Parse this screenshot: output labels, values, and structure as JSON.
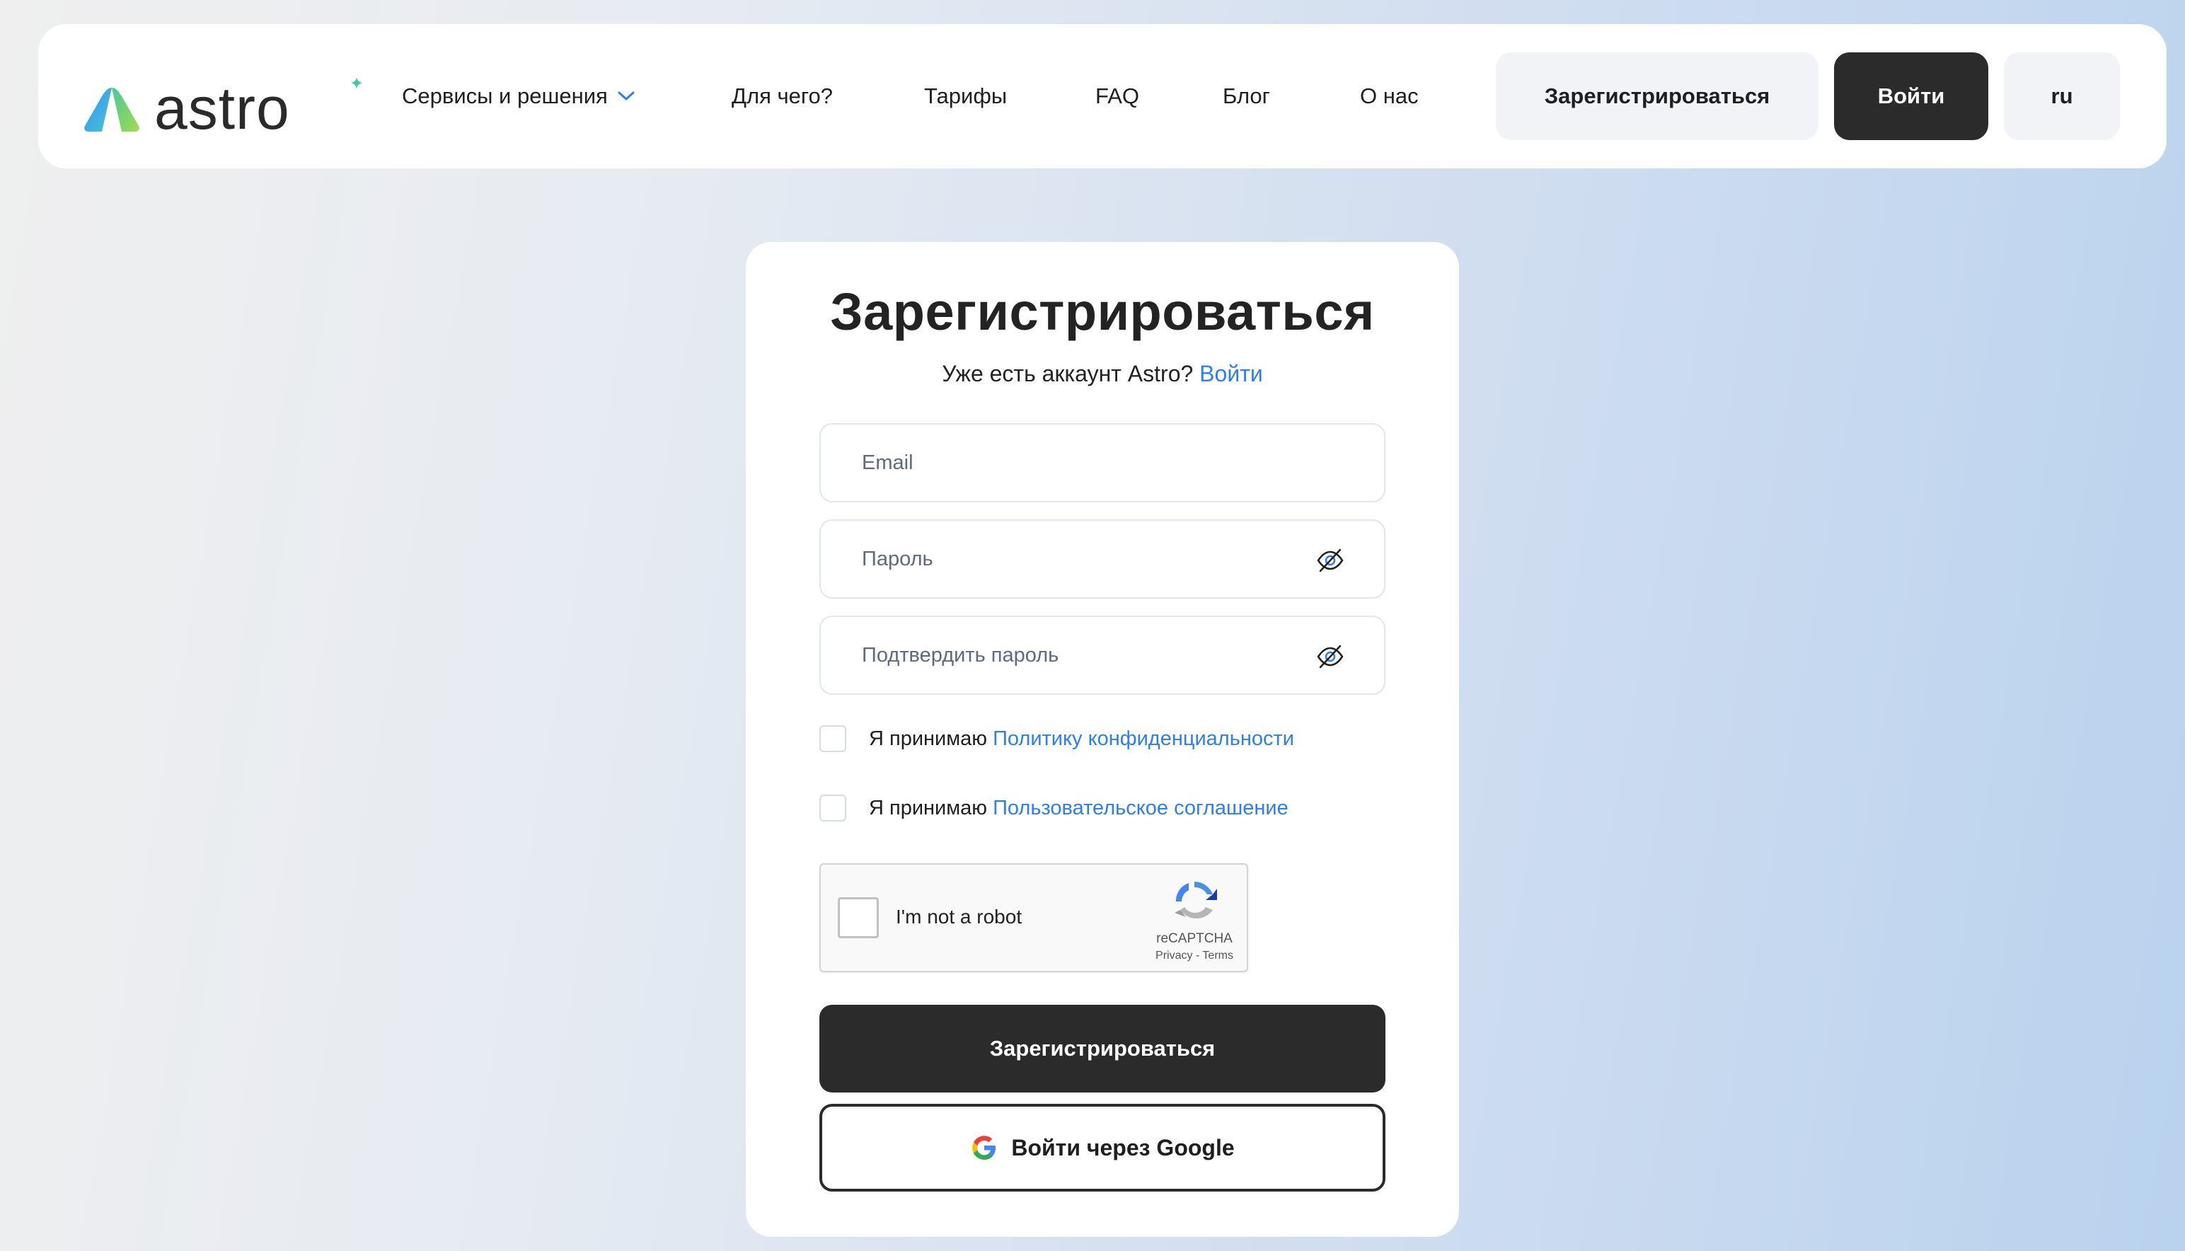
{
  "header": {
    "logo_text": "astro",
    "nav": [
      {
        "label": "Сервисы и решения",
        "has_dropdown": true
      },
      {
        "label": "Для чего?"
      },
      {
        "label": "Тарифы"
      },
      {
        "label": "FAQ"
      },
      {
        "label": "Блог"
      },
      {
        "label": "О нас"
      }
    ],
    "register_label": "Зарегистрироваться",
    "login_label": "Войти",
    "lang_label": "ru"
  },
  "form": {
    "title": "Зарегистрироваться",
    "subtitle_text": "Уже есть аккаунт Astro?",
    "subtitle_link": "Войти",
    "email_placeholder": "Email",
    "password_placeholder": "Пароль",
    "confirm_placeholder": "Подтвердить пароль",
    "privacy_prefix": "Я принимаю",
    "privacy_link": "Политику конфиденциальности",
    "terms_prefix": "Я принимаю",
    "terms_link": "Пользовательское соглашение",
    "recaptcha_label": "I'm not a robot",
    "recaptcha_brand": "reCAPTCHA",
    "recaptcha_terms": "Privacy - Terms",
    "submit_label": "Зарегистрироваться",
    "google_label": "Войти через Google"
  },
  "colors": {
    "accent_link": "#2d7ff0",
    "dark_button": "#2b2b2b",
    "light_button": "#f2f3f7"
  }
}
